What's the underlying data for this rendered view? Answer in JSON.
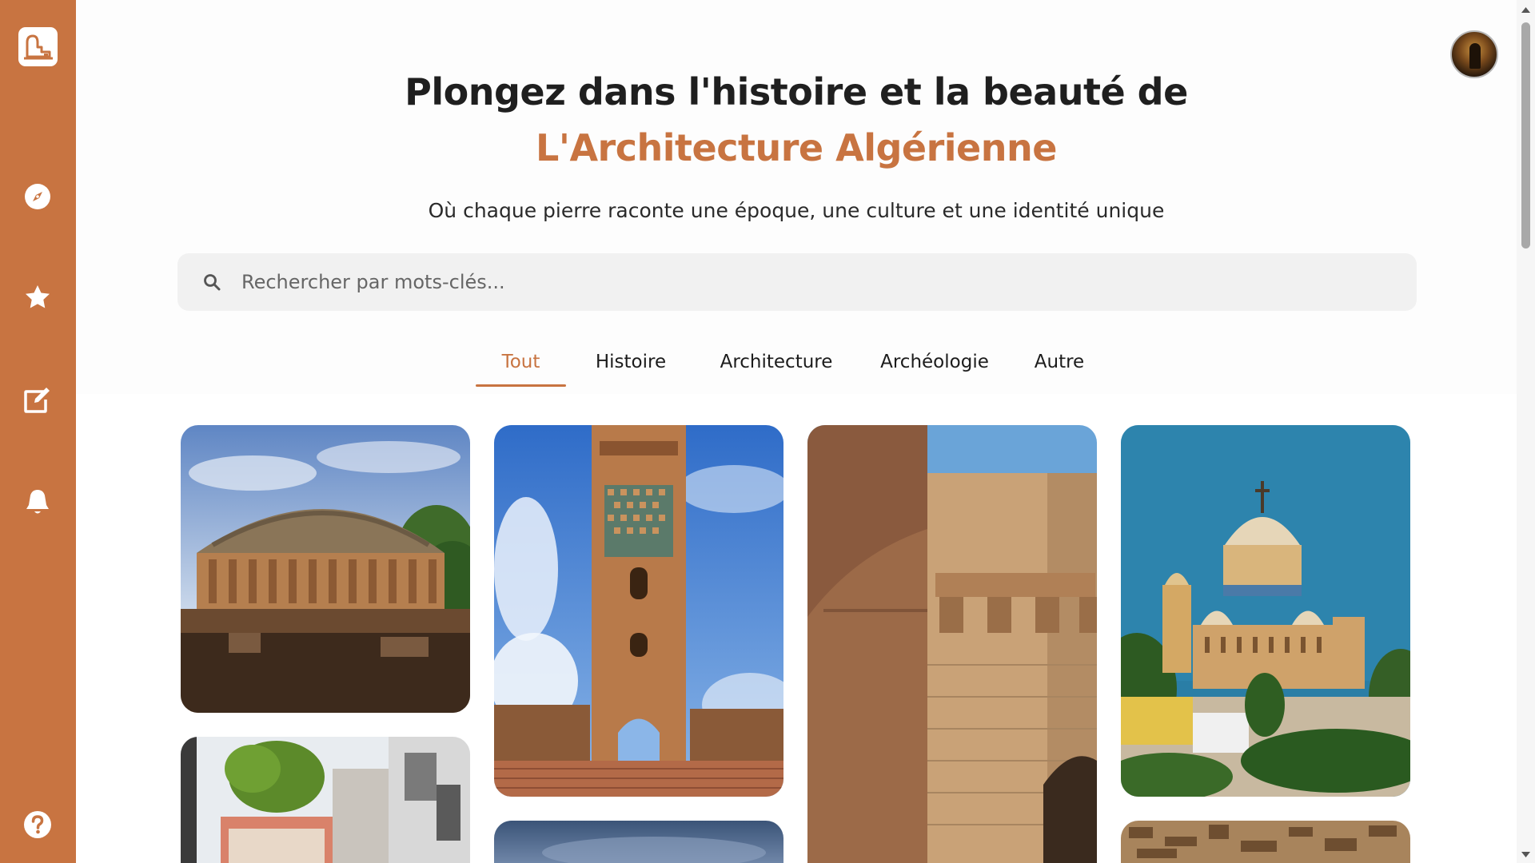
{
  "sidebar": {
    "logo": "building-logo-icon",
    "items": [
      {
        "icon": "compass-icon",
        "label": "Explorer"
      },
      {
        "icon": "star-icon",
        "label": "Favoris"
      },
      {
        "icon": "edit-icon",
        "label": "Publier"
      },
      {
        "icon": "bell-icon",
        "label": "Notifications"
      },
      {
        "icon": "help-icon",
        "label": "Aide"
      }
    ]
  },
  "hero": {
    "title_line1": "Plongez dans l'histoire et la beauté de",
    "title_line2": "L'Architecture Algérienne",
    "subtitle": "Où chaque pierre raconte une époque, une culture et une identité unique"
  },
  "search": {
    "placeholder": "Rechercher par mots-clés...",
    "value": ""
  },
  "tabs": [
    {
      "label": "Tout",
      "active": true
    },
    {
      "label": "Histoire",
      "active": false
    },
    {
      "label": "Architecture",
      "active": false
    },
    {
      "label": "Archéologie",
      "active": false
    },
    {
      "label": "Autre",
      "active": false
    }
  ],
  "gallery": [
    {
      "subject": "royal-mausoleum",
      "column": 1
    },
    {
      "subject": "casbah-street",
      "column": 1
    },
    {
      "subject": "mansourah-minaret",
      "column": 2
    },
    {
      "subject": "sky-landscape",
      "column": 2
    },
    {
      "subject": "stone-fortress-wall",
      "column": 3
    },
    {
      "subject": "notre-dame-basilica",
      "column": 4
    },
    {
      "subject": "aerial-town",
      "column": 4
    }
  ],
  "colors": {
    "accent": "#c87441",
    "title": "#1f1f1f",
    "search_bg": "#f1f1f1"
  }
}
